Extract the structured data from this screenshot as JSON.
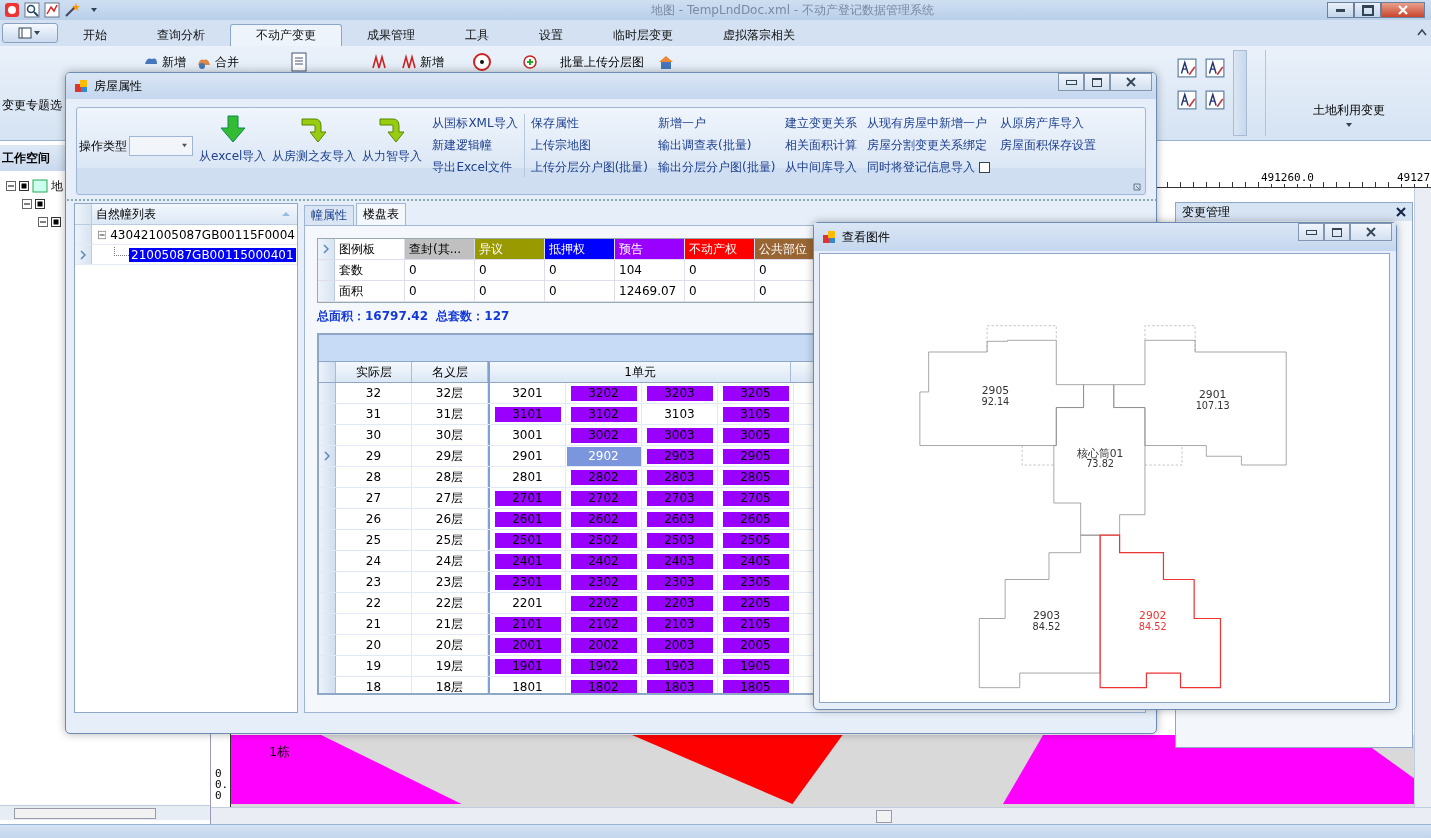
{
  "window": {
    "title": "地图 - TempLndDoc.xml - 不动产登记数据管理系统"
  },
  "ribbon": {
    "tabs": [
      {
        "label": "开始",
        "selected": false
      },
      {
        "label": "查询分析",
        "selected": false
      },
      {
        "label": "不动产变更",
        "selected": true
      },
      {
        "label": "成果管理",
        "selected": false
      },
      {
        "label": "工具",
        "selected": false
      },
      {
        "label": "设置",
        "selected": false
      },
      {
        "label": "临时层变更",
        "selected": false
      },
      {
        "label": "虚拟落宗相关",
        "selected": false
      }
    ],
    "left_group": "变更专题选",
    "add_label": "新增",
    "merge_label": "合并",
    "add2_label": "新增",
    "upload_label": "批量上传分层图",
    "right_group": "土地利用变更"
  },
  "workspace": {
    "title": "工作空间",
    "root_label": "地"
  },
  "map": {
    "ruler_labels": [
      "491260.0",
      "49127"
    ],
    "side_ruler_label": "00.0",
    "feature_label": "1栋"
  },
  "change_panel": {
    "title": "变更管理"
  },
  "house_dialog": {
    "title": "房屋属性",
    "toolbar": {
      "operation_label": "操作类型",
      "big_buttons": [
        "从excel导入",
        "从房测之友导入",
        "从力智导入"
      ],
      "link_columns": [
        [
          "从国标XML导入",
          "新建逻辑幢",
          "导出Excel文件"
        ],
        [
          "保存属性",
          "上传宗地图",
          "上传分层分户图(批量)"
        ],
        [
          "新增一户",
          "输出调查表(批量)",
          "输出分层分户图(批量)"
        ],
        [
          "建立变更关系",
          "相关面积计算",
          "从中间库导入"
        ],
        [
          "从现有房屋中新增一户",
          "房屋分割变更关系绑定",
          "同时将登记信息导入"
        ],
        [
          "从原房产库导入",
          "房屋面积保存设置"
        ]
      ],
      "sync_checkbox": {
        "checked": false
      }
    },
    "building_list": {
      "title": "自然幢列表",
      "tree": [
        {
          "label": "430421005087GB00115F0004",
          "expanded": true,
          "selected": false,
          "children": [
            {
              "label": "21005087GB00115000401",
              "selected": true
            }
          ]
        }
      ]
    },
    "tabs": [
      {
        "label": "幢属性",
        "selected": false
      },
      {
        "label": "楼盘表",
        "selected": true
      }
    ],
    "legend": {
      "title": "图例板",
      "columns": [
        {
          "label": "查封(其...",
          "color": "#c0c0c0"
        },
        {
          "label": "异议",
          "color": "#999900"
        },
        {
          "label": "抵押权",
          "color": "#0000ff"
        },
        {
          "label": "预告",
          "color": "#9900ff"
        },
        {
          "label": "不动产权",
          "color": "#ff0000"
        },
        {
          "label": "公共部位",
          "color": "#996633"
        }
      ],
      "rows": [
        {
          "label": "套数",
          "values": [
            "0",
            "0",
            "0",
            "104",
            "0",
            "0"
          ]
        },
        {
          "label": "面积",
          "values": [
            "0",
            "0",
            "0",
            "12469.07",
            "0",
            "0"
          ]
        }
      ]
    },
    "totals": "总面积：16797.42  总套数：127",
    "floors": {
      "columns": [
        "实际层",
        "名义层"
      ],
      "unit": "1单元",
      "rows": [
        {
          "actual": "32",
          "nominal": "32层",
          "current": false,
          "units": [
            {
              "no": "3201",
              "kind": "none",
              "selected": false
            },
            {
              "no": "3202",
              "kind": "presale",
              "selected": false
            },
            {
              "no": "3203",
              "kind": "presale",
              "selected": false
            },
            {
              "no": "3205",
              "kind": "presale",
              "selected": false
            }
          ]
        },
        {
          "actual": "31",
          "nominal": "31层",
          "current": false,
          "units": [
            {
              "no": "3101",
              "kind": "presale",
              "selected": false
            },
            {
              "no": "3102",
              "kind": "presale",
              "selected": false
            },
            {
              "no": "3103",
              "kind": "none",
              "selected": false
            },
            {
              "no": "3105",
              "kind": "presale",
              "selected": false
            }
          ]
        },
        {
          "actual": "30",
          "nominal": "30层",
          "current": false,
          "units": [
            {
              "no": "3001",
              "kind": "none",
              "selected": false
            },
            {
              "no": "3002",
              "kind": "presale",
              "selected": false
            },
            {
              "no": "3003",
              "kind": "presale",
              "selected": false
            },
            {
              "no": "3005",
              "kind": "presale",
              "selected": false
            }
          ]
        },
        {
          "actual": "29",
          "nominal": "29层",
          "current": true,
          "units": [
            {
              "no": "2901",
              "kind": "none",
              "selected": false
            },
            {
              "no": "2902",
              "kind": "presale",
              "selected": true
            },
            {
              "no": "2903",
              "kind": "presale",
              "selected": false
            },
            {
              "no": "2905",
              "kind": "presale",
              "selected": false
            }
          ]
        },
        {
          "actual": "28",
          "nominal": "28层",
          "current": false,
          "units": [
            {
              "no": "2801",
              "kind": "none",
              "selected": false
            },
            {
              "no": "2802",
              "kind": "presale",
              "selected": false
            },
            {
              "no": "2803",
              "kind": "presale",
              "selected": false
            },
            {
              "no": "2805",
              "kind": "presale",
              "selected": false
            }
          ]
        },
        {
          "actual": "27",
          "nominal": "27层",
          "current": false,
          "units": [
            {
              "no": "2701",
              "kind": "presale",
              "selected": false
            },
            {
              "no": "2702",
              "kind": "presale",
              "selected": false
            },
            {
              "no": "2703",
              "kind": "presale",
              "selected": false
            },
            {
              "no": "2705",
              "kind": "presale",
              "selected": false
            }
          ]
        },
        {
          "actual": "26",
          "nominal": "26层",
          "current": false,
          "units": [
            {
              "no": "2601",
              "kind": "presale",
              "selected": false
            },
            {
              "no": "2602",
              "kind": "presale",
              "selected": false
            },
            {
              "no": "2603",
              "kind": "presale",
              "selected": false
            },
            {
              "no": "2605",
              "kind": "presale",
              "selected": false
            }
          ]
        },
        {
          "actual": "25",
          "nominal": "25层",
          "current": false,
          "units": [
            {
              "no": "2501",
              "kind": "presale",
              "selected": false
            },
            {
              "no": "2502",
              "kind": "presale",
              "selected": false
            },
            {
              "no": "2503",
              "kind": "presale",
              "selected": false
            },
            {
              "no": "2505",
              "kind": "presale",
              "selected": false
            }
          ]
        },
        {
          "actual": "24",
          "nominal": "24层",
          "current": false,
          "units": [
            {
              "no": "2401",
              "kind": "presale",
              "selected": false
            },
            {
              "no": "2402",
              "kind": "presale",
              "selected": false
            },
            {
              "no": "2403",
              "kind": "presale",
              "selected": false
            },
            {
              "no": "2405",
              "kind": "presale",
              "selected": false
            }
          ]
        },
        {
          "actual": "23",
          "nominal": "23层",
          "current": false,
          "units": [
            {
              "no": "2301",
              "kind": "presale",
              "selected": false
            },
            {
              "no": "2302",
              "kind": "presale",
              "selected": false
            },
            {
              "no": "2303",
              "kind": "presale",
              "selected": false
            },
            {
              "no": "2305",
              "kind": "presale",
              "selected": false
            }
          ]
        },
        {
          "actual": "22",
          "nominal": "22层",
          "current": false,
          "units": [
            {
              "no": "2201",
              "kind": "none",
              "selected": false
            },
            {
              "no": "2202",
              "kind": "presale",
              "selected": false
            },
            {
              "no": "2203",
              "kind": "presale",
              "selected": false
            },
            {
              "no": "2205",
              "kind": "presale",
              "selected": false
            }
          ]
        },
        {
          "actual": "21",
          "nominal": "21层",
          "current": false,
          "units": [
            {
              "no": "2101",
              "kind": "presale",
              "selected": false
            },
            {
              "no": "2102",
              "kind": "presale",
              "selected": false
            },
            {
              "no": "2103",
              "kind": "presale",
              "selected": false
            },
            {
              "no": "2105",
              "kind": "presale",
              "selected": false
            }
          ]
        },
        {
          "actual": "20",
          "nominal": "20层",
          "current": false,
          "units": [
            {
              "no": "2001",
              "kind": "presale",
              "selected": false
            },
            {
              "no": "2002",
              "kind": "presale",
              "selected": false
            },
            {
              "no": "2003",
              "kind": "presale",
              "selected": false
            },
            {
              "no": "2005",
              "kind": "presale",
              "selected": false
            }
          ]
        },
        {
          "actual": "19",
          "nominal": "19层",
          "current": false,
          "units": [
            {
              "no": "1901",
              "kind": "presale",
              "selected": false
            },
            {
              "no": "1902",
              "kind": "presale",
              "selected": false
            },
            {
              "no": "1903",
              "kind": "presale",
              "selected": false
            },
            {
              "no": "1905",
              "kind": "presale",
              "selected": false
            }
          ]
        },
        {
          "actual": "18",
          "nominal": "18层",
          "current": false,
          "units": [
            {
              "no": "1801",
              "kind": "none",
              "selected": false
            },
            {
              "no": "1802",
              "kind": "presale",
              "selected": false
            },
            {
              "no": "1803",
              "kind": "presale",
              "selected": false
            },
            {
              "no": "1805",
              "kind": "presale",
              "selected": false
            }
          ]
        }
      ]
    }
  },
  "drawing_dialog": {
    "title": "查看图件",
    "rooms": [
      {
        "number": "2905",
        "area": "92.14",
        "selected": false
      },
      {
        "number": "2901",
        "area": "107.13",
        "selected": false
      },
      {
        "number": "核心筒01",
        "area": "73.82",
        "selected": false
      },
      {
        "number": "2903",
        "area": "84.52",
        "selected": false
      },
      {
        "number": "2902",
        "area": "84.52",
        "selected": true
      }
    ]
  }
}
